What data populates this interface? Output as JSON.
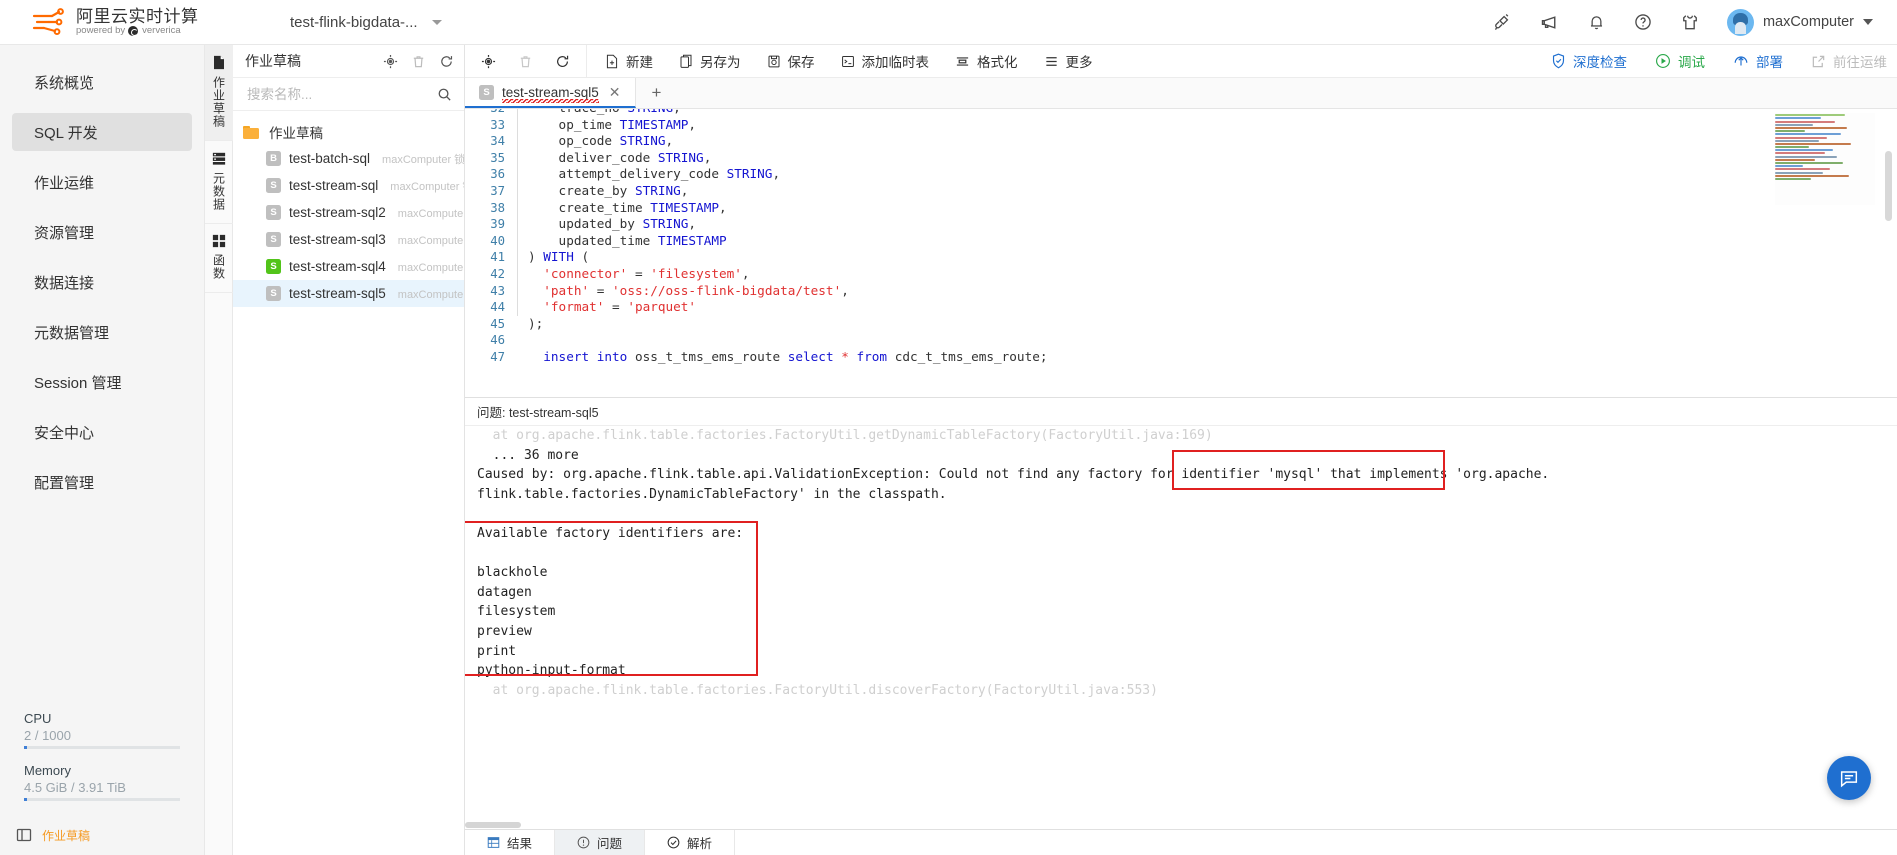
{
  "header": {
    "brand_title": "阿里云实时计算",
    "brand_sub_pre": "powered by",
    "brand_sub_post": "ververica",
    "project_name": "test-flink-bigdata-...",
    "icons": [
      "plugin-icon",
      "megaphone-icon",
      "bell-icon",
      "help-icon",
      "tshirt-icon"
    ],
    "user_name": "maxComputer"
  },
  "sidebar": {
    "items": [
      {
        "label": "系统概览",
        "active": false
      },
      {
        "label": "SQL 开发",
        "active": true
      },
      {
        "label": "作业运维",
        "active": false
      },
      {
        "label": "资源管理",
        "active": false
      },
      {
        "label": "数据连接",
        "active": false
      },
      {
        "label": "元数据管理",
        "active": false
      },
      {
        "label": "Session 管理",
        "active": false
      },
      {
        "label": "安全中心",
        "active": false
      },
      {
        "label": "配置管理",
        "active": false
      }
    ],
    "meters": [
      {
        "label": "CPU",
        "value": "2 / 1000",
        "percent": 2
      },
      {
        "label": "Memory",
        "value": "4.5 GiB / 3.91 TiB",
        "percent": 2
      }
    ],
    "footer_link": "作业草稿"
  },
  "rail": {
    "items": [
      {
        "label": "作业草稿",
        "icon": "file-icon",
        "active": true
      },
      {
        "label": "元数据",
        "icon": "database-icon",
        "active": false
      },
      {
        "label": "函数",
        "icon": "grid-icon",
        "active": false
      }
    ]
  },
  "explorer": {
    "title": "作业草稿",
    "search_placeholder": "搜索名称...",
    "root_label": "作业草稿",
    "files": [
      {
        "badge": "B",
        "badge_color": "gray",
        "name": "test-batch-sql",
        "meta": "maxComputer 锁定",
        "selected": false
      },
      {
        "badge": "S",
        "badge_color": "gray",
        "name": "test-stream-sql",
        "meta": "maxComputer 锁定",
        "selected": false
      },
      {
        "badge": "S",
        "badge_color": "gray",
        "name": "test-stream-sql2",
        "meta": "maxComputer 锁",
        "selected": false
      },
      {
        "badge": "S",
        "badge_color": "gray",
        "name": "test-stream-sql3",
        "meta": "maxComputer 锁",
        "selected": false
      },
      {
        "badge": "S",
        "badge_color": "green",
        "name": "test-stream-sql4",
        "meta": "maxComputer 锁",
        "selected": false
      },
      {
        "badge": "S",
        "badge_color": "gray",
        "name": "test-stream-sql5",
        "meta": "maxComputer 锁",
        "selected": true
      }
    ]
  },
  "toolbar": {
    "left_icons": [
      "locate-icon",
      "delete-icon",
      "refresh-icon"
    ],
    "buttons": [
      {
        "label": "新建",
        "icon": "new-file-icon"
      },
      {
        "label": "另存为",
        "icon": "save-as-icon"
      },
      {
        "label": "保存",
        "icon": "save-icon"
      },
      {
        "label": "添加临时表",
        "icon": "temp-table-icon"
      },
      {
        "label": "格式化",
        "icon": "format-icon"
      },
      {
        "label": "更多",
        "icon": "more-icon"
      }
    ],
    "right_buttons": [
      {
        "label": "深度检查",
        "icon": "shield-check-icon",
        "style": "blue"
      },
      {
        "label": "调试",
        "icon": "play-circle-icon",
        "style": "green"
      },
      {
        "label": "部署",
        "icon": "deploy-icon",
        "style": "blue"
      },
      {
        "label": "前往运维",
        "icon": "external-link-icon",
        "style": "muted"
      }
    ]
  },
  "tabs": {
    "open": [
      {
        "badge": "S",
        "title": "test-stream-sql5",
        "has_error": true,
        "active": true
      }
    ],
    "close_label": "✕",
    "add_label": "+"
  },
  "editor": {
    "lines": [
      {
        "n": "32",
        "tokens": [
          {
            "t": "    trace_no ",
            "c": "op"
          },
          {
            "t": "STRING",
            "c": "typ"
          },
          {
            "t": ",",
            "c": "punc"
          }
        ],
        "clipped": true
      },
      {
        "n": "33",
        "tokens": [
          {
            "t": "    op_time ",
            "c": "op"
          },
          {
            "t": "TIMESTAMP",
            "c": "typ"
          },
          {
            "t": ",",
            "c": "punc"
          }
        ]
      },
      {
        "n": "34",
        "tokens": [
          {
            "t": "    op_code ",
            "c": "op"
          },
          {
            "t": "STRING",
            "c": "typ"
          },
          {
            "t": ",",
            "c": "punc"
          }
        ]
      },
      {
        "n": "35",
        "tokens": [
          {
            "t": "    deliver_code ",
            "c": "op"
          },
          {
            "t": "STRING",
            "c": "typ"
          },
          {
            "t": ",",
            "c": "punc"
          }
        ]
      },
      {
        "n": "36",
        "tokens": [
          {
            "t": "    attempt_delivery_code ",
            "c": "op"
          },
          {
            "t": "STRING",
            "c": "typ"
          },
          {
            "t": ",",
            "c": "punc"
          }
        ]
      },
      {
        "n": "37",
        "tokens": [
          {
            "t": "    create_by ",
            "c": "op"
          },
          {
            "t": "STRING",
            "c": "typ"
          },
          {
            "t": ",",
            "c": "punc"
          }
        ]
      },
      {
        "n": "38",
        "tokens": [
          {
            "t": "    create_time ",
            "c": "op"
          },
          {
            "t": "TIMESTAMP",
            "c": "typ"
          },
          {
            "t": ",",
            "c": "punc"
          }
        ]
      },
      {
        "n": "39",
        "tokens": [
          {
            "t": "    updated_by ",
            "c": "op"
          },
          {
            "t": "STRING",
            "c": "typ"
          },
          {
            "t": ",",
            "c": "punc"
          }
        ]
      },
      {
        "n": "40",
        "tokens": [
          {
            "t": "    updated_time ",
            "c": "op"
          },
          {
            "t": "TIMESTAMP",
            "c": "typ"
          }
        ]
      },
      {
        "n": "41",
        "tokens": [
          {
            "t": ") ",
            "c": "punc"
          },
          {
            "t": "WITH",
            "c": "kw"
          },
          {
            "t": " (",
            "c": "punc"
          }
        ]
      },
      {
        "n": "42",
        "tokens": [
          {
            "t": "  ",
            "c": "op"
          },
          {
            "t": "'connector'",
            "c": "str"
          },
          {
            "t": " = ",
            "c": "op"
          },
          {
            "t": "'filesystem'",
            "c": "str"
          },
          {
            "t": ",",
            "c": "punc"
          }
        ]
      },
      {
        "n": "43",
        "tokens": [
          {
            "t": "  ",
            "c": "op"
          },
          {
            "t": "'path'",
            "c": "str"
          },
          {
            "t": " = ",
            "c": "op"
          },
          {
            "t": "'oss://oss-flink-bigdata/test'",
            "c": "str"
          },
          {
            "t": ",",
            "c": "punc"
          }
        ]
      },
      {
        "n": "44",
        "tokens": [
          {
            "t": "  ",
            "c": "op"
          },
          {
            "t": "'format'",
            "c": "str"
          },
          {
            "t": " = ",
            "c": "op"
          },
          {
            "t": "'parquet'",
            "c": "str"
          }
        ]
      },
      {
        "n": "45",
        "tokens": [
          {
            "t": ");",
            "c": "punc"
          }
        ]
      },
      {
        "n": "46",
        "tokens": []
      },
      {
        "n": "47",
        "tokens": [
          {
            "t": "  ",
            "c": "op"
          },
          {
            "t": "insert",
            "c": "kw"
          },
          {
            "t": " ",
            "c": "op"
          },
          {
            "t": "into",
            "c": "kw"
          },
          {
            "t": " oss_t_tms_ems_route ",
            "c": "op"
          },
          {
            "t": "select",
            "c": "kw"
          },
          {
            "t": " ",
            "c": "op"
          },
          {
            "t": "*",
            "c": "str"
          },
          {
            "t": " ",
            "c": "op"
          },
          {
            "t": "from",
            "c": "kw"
          },
          {
            "t": " cdc_t_tms_ems_route;",
            "c": "op"
          }
        ]
      }
    ]
  },
  "problems": {
    "title": "问题: test-stream-sql5",
    "lines": [
      {
        "text": "  at org.apache.flink.table.factories.FactoryUtil.getDynamicTableFactory(FactoryUtil.java:169)",
        "faded": true
      },
      {
        "text": "  ... 36 more",
        "faded": false
      },
      {
        "text": "Caused by: org.apache.flink.table.api.ValidationException: Could not find any factory for identifier 'mysql' that implements 'org.apache.",
        "faded": false
      },
      {
        "text": "flink.table.factories.DynamicTableFactory' in the classpath.",
        "faded": false
      },
      {
        "text": "",
        "faded": false
      },
      {
        "text": "Available factory identifiers are:",
        "faded": false
      },
      {
        "text": "",
        "faded": false
      },
      {
        "text": "blackhole",
        "faded": false
      },
      {
        "text": "datagen",
        "faded": false
      },
      {
        "text": "filesystem",
        "faded": false
      },
      {
        "text": "preview",
        "faded": false
      },
      {
        "text": "print",
        "faded": false
      },
      {
        "text": "python-input-format",
        "faded": false
      },
      {
        "text": "  at org.apache.flink.table.factories.FactoryUtil.discoverFactory(FactoryUtil.java:553)",
        "faded": true
      }
    ],
    "bottom_tabs": [
      {
        "label": "结果",
        "icon": "result-icon",
        "active": false
      },
      {
        "label": "问题",
        "icon": "warning-icon",
        "active": true
      },
      {
        "label": "解析",
        "icon": "check-icon",
        "active": false
      }
    ]
  },
  "fab": {
    "icon": "chat-icon"
  },
  "colors": {
    "accent_blue": "#1f6fd0",
    "error_red": "#e02020",
    "success_green": "#52c41a",
    "orange": "#f5a623"
  }
}
